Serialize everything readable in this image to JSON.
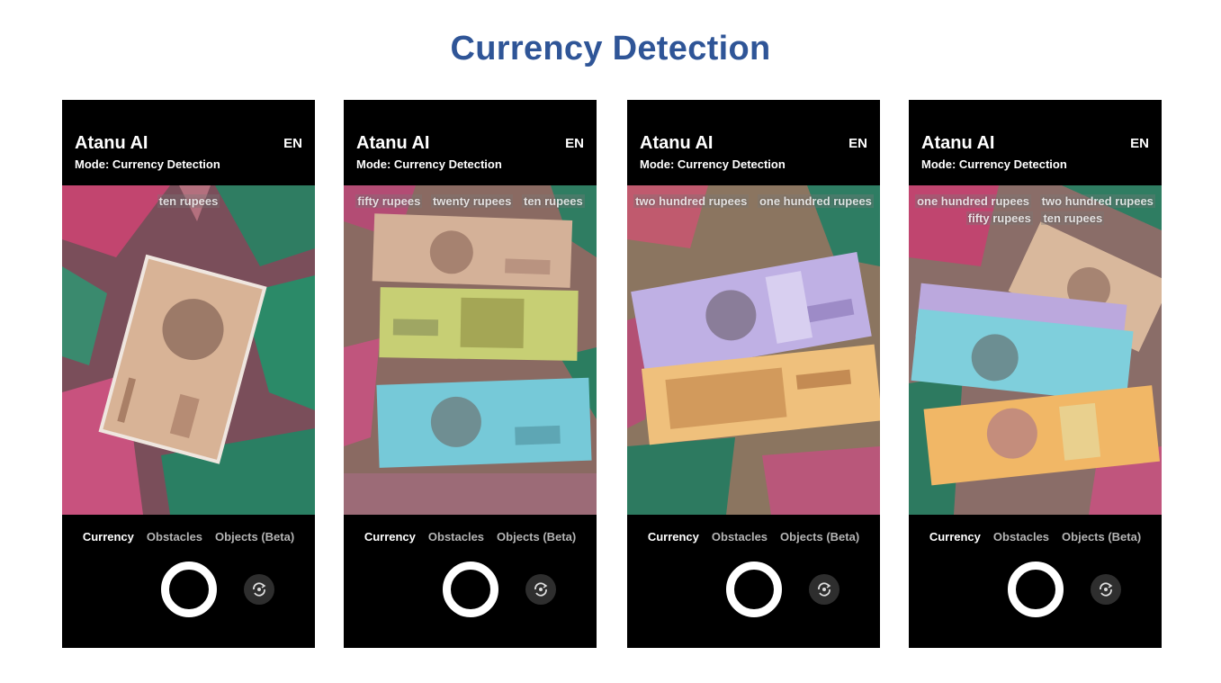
{
  "title": "Currency Detection",
  "phones": [
    {
      "app_name": "Atanu AI",
      "language": "EN",
      "mode": "Mode: Currency Detection",
      "detections": [
        "ten rupees"
      ],
      "tabs": [
        "Currency",
        "Obstacles",
        "Objects (Beta)"
      ],
      "active_tab": "Currency"
    },
    {
      "app_name": "Atanu AI",
      "language": "EN",
      "mode": "Mode: Currency Detection",
      "detections": [
        "fifty rupees",
        "twenty rupees",
        "ten rupees"
      ],
      "tabs": [
        "Currency",
        "Obstacles",
        "Objects (Beta)"
      ],
      "active_tab": "Currency"
    },
    {
      "app_name": "Atanu AI",
      "language": "EN",
      "mode": "Mode: Currency Detection",
      "detections": [
        "two hundred rupees",
        "one hundred rupees"
      ],
      "tabs": [
        "Currency",
        "Obstacles",
        "Objects (Beta)"
      ],
      "active_tab": "Currency"
    },
    {
      "app_name": "Atanu AI",
      "language": "EN",
      "mode": "Mode: Currency Detection",
      "detections": [
        "one hundred rupees",
        "two hundred rupees",
        "fifty rupees",
        "ten rupees"
      ],
      "tabs": [
        "Currency",
        "Obstacles",
        "Objects (Beta)"
      ],
      "active_tab": "Currency"
    }
  ],
  "icons": {
    "shutter": "shutter-button-icon",
    "flip": "flip-camera-icon"
  },
  "colors": {
    "title": "#2f5597",
    "note_10": "#c99c7a",
    "note_20": "#c9d27a",
    "note_50": "#7fd0dd",
    "note_100": "#b9a6dc",
    "note_200": "#f0b86a"
  }
}
